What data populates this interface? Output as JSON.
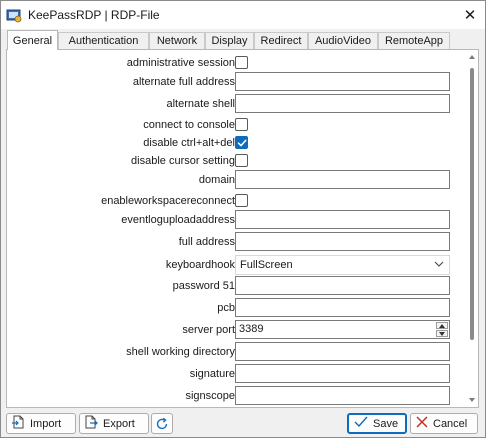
{
  "window": {
    "title": "KeePassRDP | RDP-File",
    "close_glyph": "✕"
  },
  "tabs": [
    {
      "label": "General",
      "active": true
    },
    {
      "label": "Authentication",
      "active": false
    },
    {
      "label": "Network",
      "active": false
    },
    {
      "label": "Display",
      "active": false
    },
    {
      "label": "Redirect",
      "active": false
    },
    {
      "label": "AudioVideo",
      "active": false
    },
    {
      "label": "RemoteApp",
      "active": false
    }
  ],
  "fields": [
    {
      "label": "administrative session",
      "type": "checkbox",
      "checked": false
    },
    {
      "label": "alternate full address",
      "type": "text",
      "value": ""
    },
    {
      "label": "alternate shell",
      "type": "text",
      "value": ""
    },
    {
      "label": "connect to console",
      "type": "checkbox",
      "checked": false
    },
    {
      "label": "disable ctrl+alt+del",
      "type": "checkbox",
      "checked": true
    },
    {
      "label": "disable cursor setting",
      "type": "checkbox",
      "checked": false
    },
    {
      "label": "domain",
      "type": "text",
      "value": ""
    },
    {
      "label": "enableworkspacereconnect",
      "type": "checkbox",
      "checked": false
    },
    {
      "label": "eventloguploadaddress",
      "type": "text",
      "value": ""
    },
    {
      "label": "full address",
      "type": "text",
      "value": ""
    },
    {
      "label": "keyboardhook",
      "type": "select",
      "value": "FullScreen"
    },
    {
      "label": "password 51",
      "type": "text",
      "value": ""
    },
    {
      "label": "pcb",
      "type": "text",
      "value": ""
    },
    {
      "label": "server port",
      "type": "number",
      "value": "3389"
    },
    {
      "label": "shell working directory",
      "type": "text",
      "value": ""
    },
    {
      "label": "signature",
      "type": "text",
      "value": ""
    },
    {
      "label": "signscope",
      "type": "text",
      "value": ""
    }
  ],
  "footer": {
    "import_label": "Import",
    "export_label": "Export",
    "save_label": "Save",
    "cancel_label": "Cancel"
  },
  "colors": {
    "accent": "#0f6cbd",
    "cancel_red": "#c42b1c"
  }
}
